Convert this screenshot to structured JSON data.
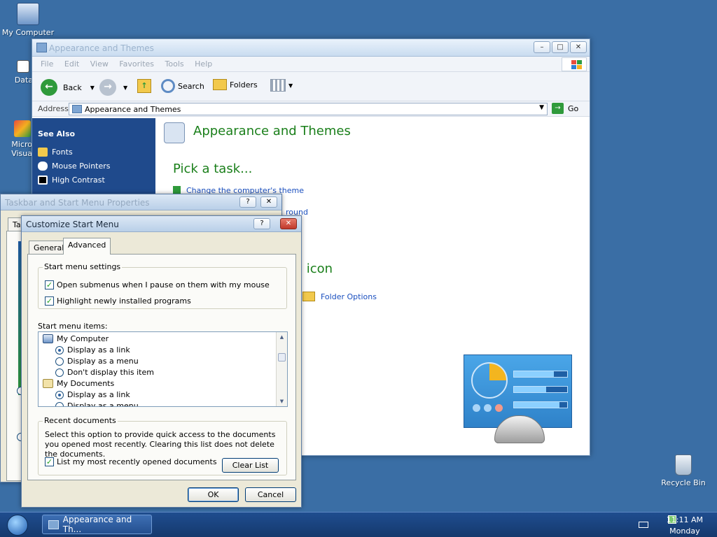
{
  "desktop": {
    "icons": [
      {
        "label": "My Computer"
      },
      {
        "label": "DataWa"
      },
      {
        "label": "Micro Visua"
      },
      {
        "label": "Recycle Bin"
      }
    ]
  },
  "explorer": {
    "title": "Appearance and Themes",
    "menu": [
      "File",
      "Edit",
      "View",
      "Favorites",
      "Tools",
      "Help"
    ],
    "toolbar": {
      "back": "Back",
      "search": "Search",
      "folders": "Folders"
    },
    "address": {
      "label": "Address",
      "value": "Appearance and Themes",
      "go": "Go"
    },
    "sidebar": {
      "heading": "See Also",
      "items": [
        {
          "label": "Fonts",
          "icon": "folder-icon",
          "color": "#f2c94c"
        },
        {
          "label": "Mouse Pointers",
          "icon": "mouse-icon",
          "color": "#ffffff"
        },
        {
          "label": "High Contrast",
          "icon": "contrast-icon",
          "color": "#000000"
        }
      ]
    },
    "content": {
      "title": "Appearance and Themes",
      "pick_task": "Pick a task...",
      "tasks": [
        "Change the computer's theme",
        "round"
      ],
      "cp_heading": "l icon",
      "cp_items": [
        {
          "label": "Folder Options"
        }
      ]
    }
  },
  "taskbar_props": {
    "title": "Taskbar and Start Menu Properties",
    "tab_partial": "Ta"
  },
  "customize": {
    "title": "Customize Start Menu",
    "tabs": [
      "General",
      "Advanced"
    ],
    "active_tab": "Advanced",
    "start_menu_settings": {
      "label": "Start menu settings",
      "options": [
        {
          "label": "Open submenus when I pause on them with my mouse",
          "checked": true
        },
        {
          "label": "Highlight newly installed programs",
          "checked": true
        }
      ]
    },
    "items_label": "Start menu items:",
    "items": {
      "my_computer": "My Computer",
      "my_computer_options": [
        {
          "label": "Display as a link",
          "selected": true
        },
        {
          "label": "Display as a menu",
          "selected": false
        },
        {
          "label": "Don't display this item",
          "selected": false
        }
      ],
      "my_documents": "My Documents",
      "my_documents_options": [
        {
          "label": "Display as a link",
          "selected": true
        },
        {
          "label": "Display as a menu",
          "selected": false
        }
      ]
    },
    "recent": {
      "label": "Recent documents",
      "description": "Select this option to provide quick access to the documents you opened most recently.  Clearing this list does not delete the documents.",
      "checkbox": "List my most recently opened documents",
      "checked": true,
      "clear_button": "Clear List"
    },
    "ok": "OK",
    "cancel": "Cancel"
  },
  "taskbar": {
    "task_label": "Appearance and Th...",
    "time": "11:11 AM",
    "day": "Monday"
  },
  "colors": {
    "desktop": "#3a6ea5",
    "sidebar": "#1f4a8c",
    "heading_green": "#1a7f1a",
    "link_blue": "#1a4fbf"
  }
}
